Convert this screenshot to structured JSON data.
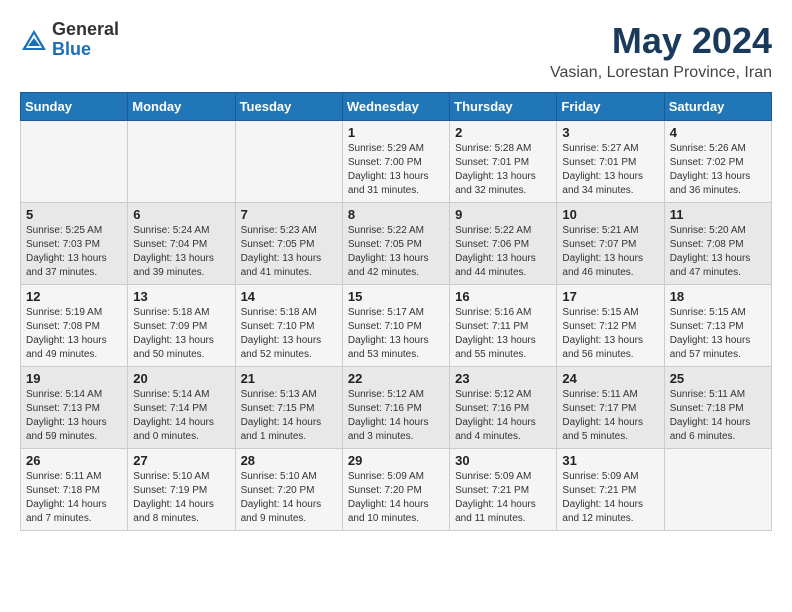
{
  "header": {
    "logo": {
      "general": "General",
      "blue": "Blue"
    },
    "title": "May 2024",
    "subtitle": "Vasian, Lorestan Province, Iran"
  },
  "weekdays": [
    "Sunday",
    "Monday",
    "Tuesday",
    "Wednesday",
    "Thursday",
    "Friday",
    "Saturday"
  ],
  "weeks": [
    [
      {
        "day": null,
        "info": null
      },
      {
        "day": null,
        "info": null
      },
      {
        "day": null,
        "info": null
      },
      {
        "day": "1",
        "info": "Sunrise: 5:29 AM\nSunset: 7:00 PM\nDaylight: 13 hours\nand 31 minutes."
      },
      {
        "day": "2",
        "info": "Sunrise: 5:28 AM\nSunset: 7:01 PM\nDaylight: 13 hours\nand 32 minutes."
      },
      {
        "day": "3",
        "info": "Sunrise: 5:27 AM\nSunset: 7:01 PM\nDaylight: 13 hours\nand 34 minutes."
      },
      {
        "day": "4",
        "info": "Sunrise: 5:26 AM\nSunset: 7:02 PM\nDaylight: 13 hours\nand 36 minutes."
      }
    ],
    [
      {
        "day": "5",
        "info": "Sunrise: 5:25 AM\nSunset: 7:03 PM\nDaylight: 13 hours\nand 37 minutes."
      },
      {
        "day": "6",
        "info": "Sunrise: 5:24 AM\nSunset: 7:04 PM\nDaylight: 13 hours\nand 39 minutes."
      },
      {
        "day": "7",
        "info": "Sunrise: 5:23 AM\nSunset: 7:05 PM\nDaylight: 13 hours\nand 41 minutes."
      },
      {
        "day": "8",
        "info": "Sunrise: 5:22 AM\nSunset: 7:05 PM\nDaylight: 13 hours\nand 42 minutes."
      },
      {
        "day": "9",
        "info": "Sunrise: 5:22 AM\nSunset: 7:06 PM\nDaylight: 13 hours\nand 44 minutes."
      },
      {
        "day": "10",
        "info": "Sunrise: 5:21 AM\nSunset: 7:07 PM\nDaylight: 13 hours\nand 46 minutes."
      },
      {
        "day": "11",
        "info": "Sunrise: 5:20 AM\nSunset: 7:08 PM\nDaylight: 13 hours\nand 47 minutes."
      }
    ],
    [
      {
        "day": "12",
        "info": "Sunrise: 5:19 AM\nSunset: 7:08 PM\nDaylight: 13 hours\nand 49 minutes."
      },
      {
        "day": "13",
        "info": "Sunrise: 5:18 AM\nSunset: 7:09 PM\nDaylight: 13 hours\nand 50 minutes."
      },
      {
        "day": "14",
        "info": "Sunrise: 5:18 AM\nSunset: 7:10 PM\nDaylight: 13 hours\nand 52 minutes."
      },
      {
        "day": "15",
        "info": "Sunrise: 5:17 AM\nSunset: 7:10 PM\nDaylight: 13 hours\nand 53 minutes."
      },
      {
        "day": "16",
        "info": "Sunrise: 5:16 AM\nSunset: 7:11 PM\nDaylight: 13 hours\nand 55 minutes."
      },
      {
        "day": "17",
        "info": "Sunrise: 5:15 AM\nSunset: 7:12 PM\nDaylight: 13 hours\nand 56 minutes."
      },
      {
        "day": "18",
        "info": "Sunrise: 5:15 AM\nSunset: 7:13 PM\nDaylight: 13 hours\nand 57 minutes."
      }
    ],
    [
      {
        "day": "19",
        "info": "Sunrise: 5:14 AM\nSunset: 7:13 PM\nDaylight: 13 hours\nand 59 minutes."
      },
      {
        "day": "20",
        "info": "Sunrise: 5:14 AM\nSunset: 7:14 PM\nDaylight: 14 hours\nand 0 minutes."
      },
      {
        "day": "21",
        "info": "Sunrise: 5:13 AM\nSunset: 7:15 PM\nDaylight: 14 hours\nand 1 minutes."
      },
      {
        "day": "22",
        "info": "Sunrise: 5:12 AM\nSunset: 7:16 PM\nDaylight: 14 hours\nand 3 minutes."
      },
      {
        "day": "23",
        "info": "Sunrise: 5:12 AM\nSunset: 7:16 PM\nDaylight: 14 hours\nand 4 minutes."
      },
      {
        "day": "24",
        "info": "Sunrise: 5:11 AM\nSunset: 7:17 PM\nDaylight: 14 hours\nand 5 minutes."
      },
      {
        "day": "25",
        "info": "Sunrise: 5:11 AM\nSunset: 7:18 PM\nDaylight: 14 hours\nand 6 minutes."
      }
    ],
    [
      {
        "day": "26",
        "info": "Sunrise: 5:11 AM\nSunset: 7:18 PM\nDaylight: 14 hours\nand 7 minutes."
      },
      {
        "day": "27",
        "info": "Sunrise: 5:10 AM\nSunset: 7:19 PM\nDaylight: 14 hours\nand 8 minutes."
      },
      {
        "day": "28",
        "info": "Sunrise: 5:10 AM\nSunset: 7:20 PM\nDaylight: 14 hours\nand 9 minutes."
      },
      {
        "day": "29",
        "info": "Sunrise: 5:09 AM\nSunset: 7:20 PM\nDaylight: 14 hours\nand 10 minutes."
      },
      {
        "day": "30",
        "info": "Sunrise: 5:09 AM\nSunset: 7:21 PM\nDaylight: 14 hours\nand 11 minutes."
      },
      {
        "day": "31",
        "info": "Sunrise: 5:09 AM\nSunset: 7:21 PM\nDaylight: 14 hours\nand 12 minutes."
      },
      {
        "day": null,
        "info": null
      }
    ]
  ]
}
